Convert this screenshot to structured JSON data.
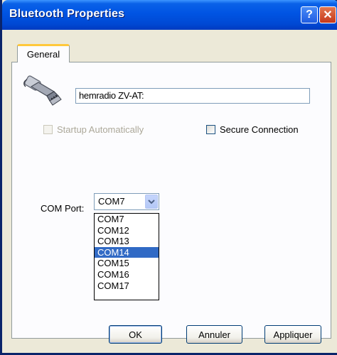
{
  "window": {
    "title": "Bluetooth Properties",
    "help_glyph": "?",
    "close_glyph": "✕"
  },
  "tabs": [
    {
      "label": "General",
      "active": true
    }
  ],
  "device": {
    "icon": "serial-port-connector-icon",
    "name_value": "hemradio ZV-AT:"
  },
  "options": {
    "startup_label": "Startup Automatically",
    "startup_checked": false,
    "startup_enabled": false,
    "secure_label": "Secure Connection",
    "secure_checked": false
  },
  "com_port": {
    "label": "COM Port:",
    "selected_value": "COM7",
    "dropdown_open": true,
    "options": [
      "COM7",
      "COM12",
      "COM13",
      "COM14",
      "COM15",
      "COM16",
      "COM17"
    ],
    "highlighted": "COM14"
  },
  "buttons": {
    "ok": "OK",
    "cancel": "Annuler",
    "apply": "Appliquer"
  },
  "colors": {
    "titlebar": "#0054e3",
    "selection": "#316ac5",
    "tab_accent": "#ffc83c",
    "close_button": "#c7381b"
  }
}
